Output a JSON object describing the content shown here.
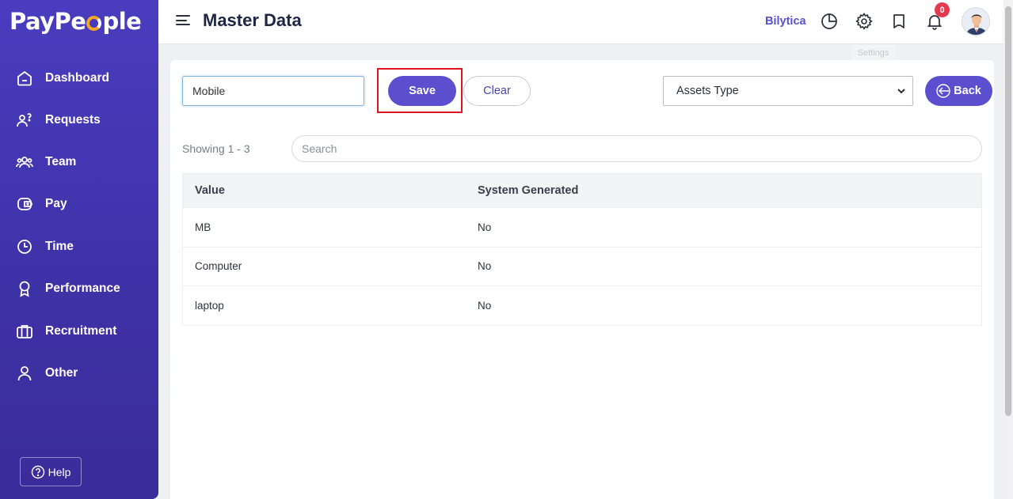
{
  "brand": {
    "logo_pre": "PayPe",
    "logo_post": "ple"
  },
  "sidebar": {
    "items": [
      {
        "label": "Dashboard",
        "icon": "home-icon"
      },
      {
        "label": "Requests",
        "icon": "requests-icon"
      },
      {
        "label": "Team",
        "icon": "team-icon"
      },
      {
        "label": "Pay",
        "icon": "pay-icon"
      },
      {
        "label": "Time",
        "icon": "clock-icon"
      },
      {
        "label": "Performance",
        "icon": "award-icon"
      },
      {
        "label": "Recruitment",
        "icon": "briefcase-icon"
      },
      {
        "label": "Other",
        "icon": "user-icon"
      }
    ],
    "help_label": "Help"
  },
  "header": {
    "title": "Master Data",
    "company": "Bilytica",
    "notification_count": "0",
    "tooltip": "Settings"
  },
  "form": {
    "value_input": "Mobile",
    "save_label": "Save",
    "clear_label": "Clear",
    "type_select": "Assets Type",
    "back_label": "Back"
  },
  "list": {
    "showing": "Showing 1 - 3",
    "search_placeholder": "Search",
    "columns": [
      "Value",
      "System Generated"
    ],
    "rows": [
      [
        "MB",
        "No"
      ],
      [
        "Computer",
        "No"
      ],
      [
        "laptop",
        "No"
      ]
    ]
  }
}
